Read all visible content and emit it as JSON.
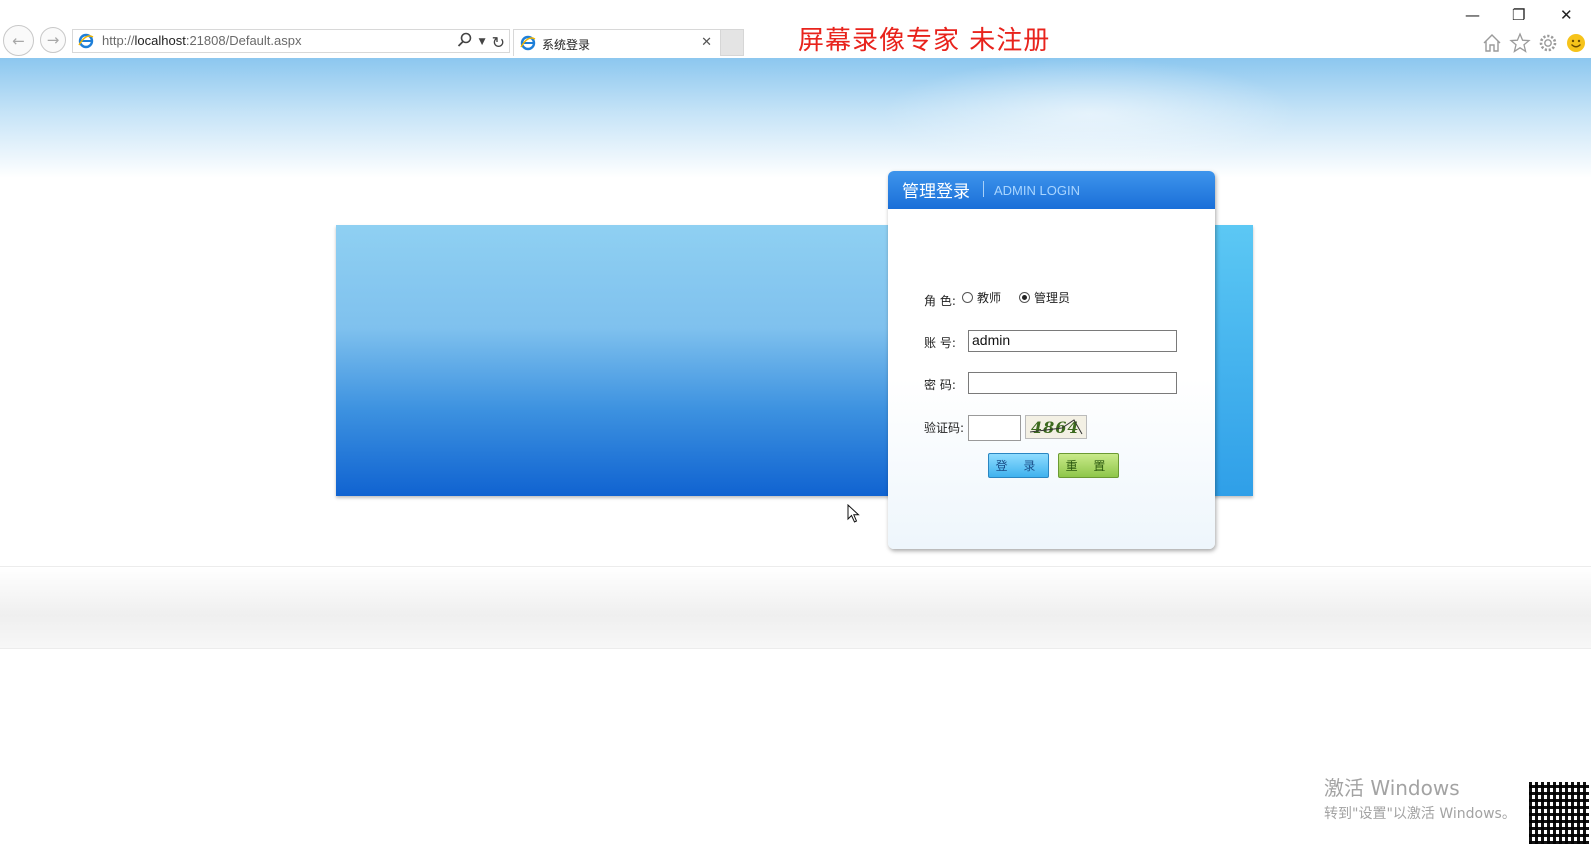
{
  "browser": {
    "url_prefix": "http://",
    "url_host": "localhost",
    "url_rest": ":21808/Default.aspx",
    "tab_title": "系统登录",
    "recorder_watermark": "屏幕录像专家  未注册"
  },
  "login": {
    "title_cn": "管理登录",
    "title_en": "ADMIN LOGIN",
    "role_label": "角 色:",
    "role_teacher": "教师",
    "role_admin": "管理员",
    "role_selected": "管理员",
    "account_label": "账  号:",
    "account_value": "admin",
    "password_label": "密  码:",
    "password_value": "",
    "captcha_label": "验证码:",
    "captcha_text": "4864",
    "login_button": "登 录",
    "reset_button": "重 置"
  },
  "os_watermark": {
    "line1": "激活 Windows",
    "line2": "转到\"设置\"以激活 Windows。"
  },
  "colors": {
    "header_blue": "#1a6fd8",
    "banner_blue": "#1063d1",
    "watermark_red": "#e8231c"
  }
}
